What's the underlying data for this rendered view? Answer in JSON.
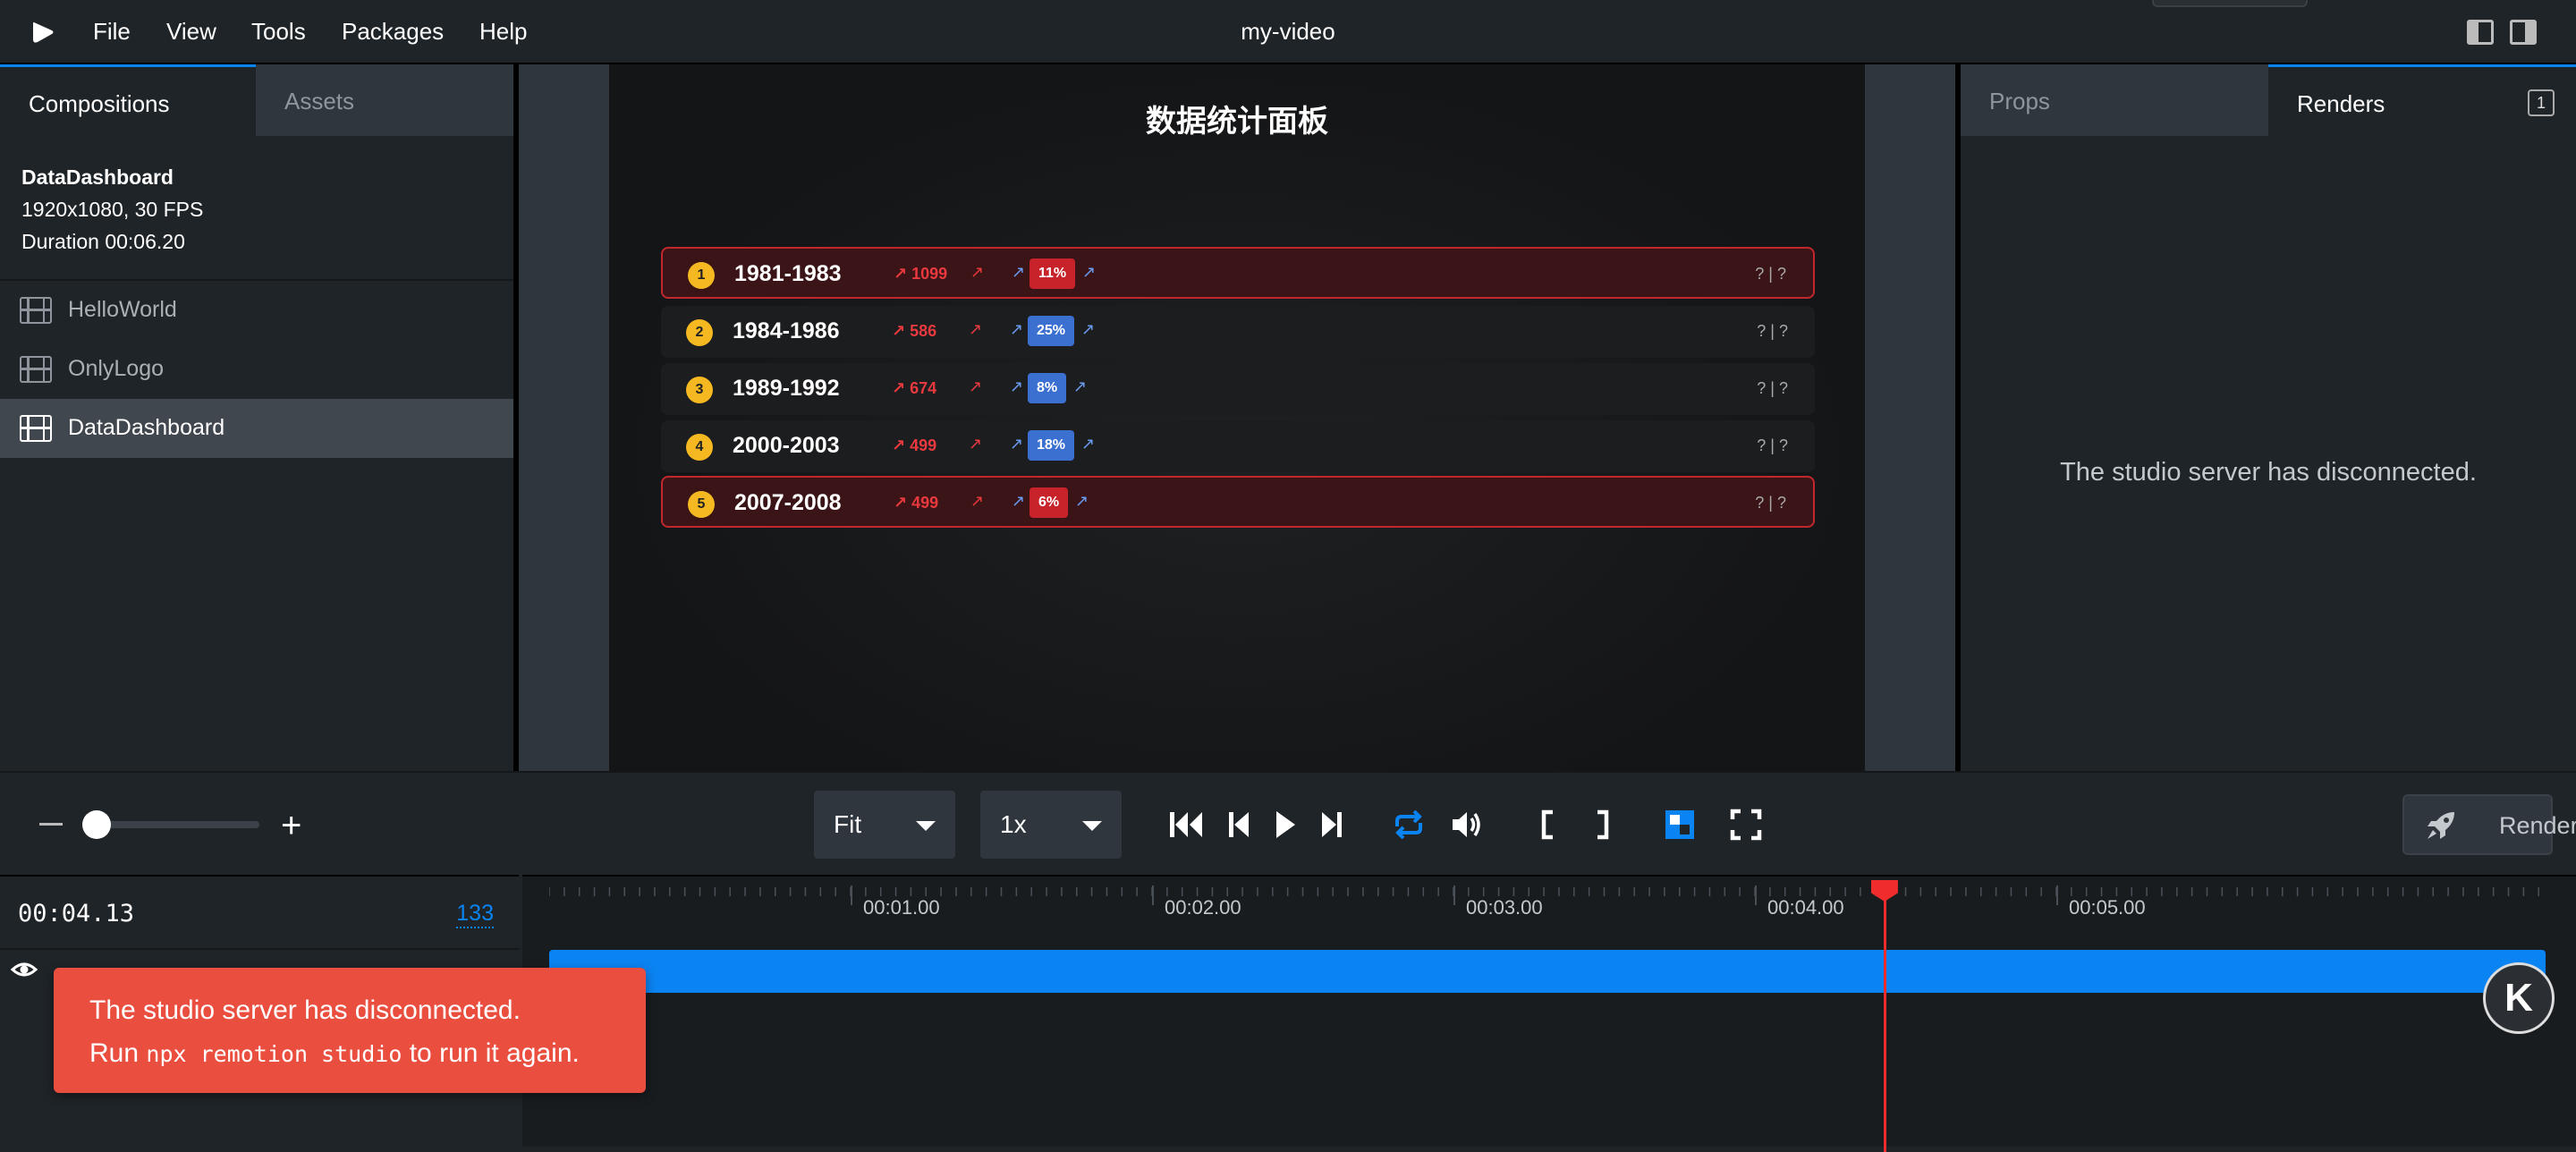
{
  "app": {
    "title": "my-video",
    "menu": [
      "File",
      "View",
      "Tools",
      "Packages",
      "Help"
    ]
  },
  "left_panel": {
    "tabs": [
      {
        "label": "Compositions",
        "active": true
      },
      {
        "label": "Assets",
        "active": false
      }
    ],
    "current": {
      "name": "DataDashboard",
      "resolution": "1920x1080, 30 FPS",
      "duration": "Duration 00:06.20"
    },
    "compositions": [
      {
        "label": "HelloWorld",
        "active": false
      },
      {
        "label": "OnlyLogo",
        "active": false
      },
      {
        "label": "DataDashboard",
        "active": true
      }
    ]
  },
  "video": {
    "title": "数据统计面板",
    "rows": [
      {
        "rank": "1",
        "period": "1981-1983",
        "value": "↗ 1099",
        "pct": "11%",
        "pct_color": "#c8232a",
        "highlight": true,
        "tail": "? | ?"
      },
      {
        "rank": "2",
        "period": "1984-1986",
        "value": "↗ 586",
        "pct": "25%",
        "pct_color": "#3b6fd0",
        "highlight": false,
        "tail": "? | ?"
      },
      {
        "rank": "3",
        "period": "1989-1992",
        "value": "↗ 674",
        "pct": "8%",
        "pct_color": "#3b6fd0",
        "highlight": false,
        "tail": "? | ?"
      },
      {
        "rank": "4",
        "period": "2000-2003",
        "value": "↗ 499",
        "pct": "18%",
        "pct_color": "#3b6fd0",
        "highlight": false,
        "tail": "? | ?"
      },
      {
        "rank": "5",
        "period": "2007-2008",
        "value": "↗ 499",
        "pct": "6%",
        "pct_color": "#c8232a",
        "highlight": true,
        "tail": "? | ?"
      }
    ]
  },
  "right_panel": {
    "tabs": [
      {
        "label": "Props",
        "active": false
      },
      {
        "label": "Renders",
        "active": true
      }
    ],
    "badge": "1",
    "message": "The studio server has disconnected."
  },
  "controls": {
    "size_select": "Fit",
    "speed_select": "1x",
    "render_label": "Render"
  },
  "timeline": {
    "time": "00:04.13",
    "frame": "133",
    "ruler": [
      "00:01.00",
      "00:02.00",
      "00:03.00",
      "00:04.00",
      "00:05.00"
    ],
    "playhead_seconds": 4.43
  },
  "toast": {
    "line1": "The studio server has disconnected.",
    "line2_pre": "Run",
    "line2_code": "npx remotion studio",
    "line2_post": "to run it again."
  },
  "avatar_letter": "K",
  "colors": {
    "accent": "#0b84f3",
    "error": "#e94e3f",
    "playhead": "#f02c2c",
    "rank_badge": "#f5b820"
  }
}
